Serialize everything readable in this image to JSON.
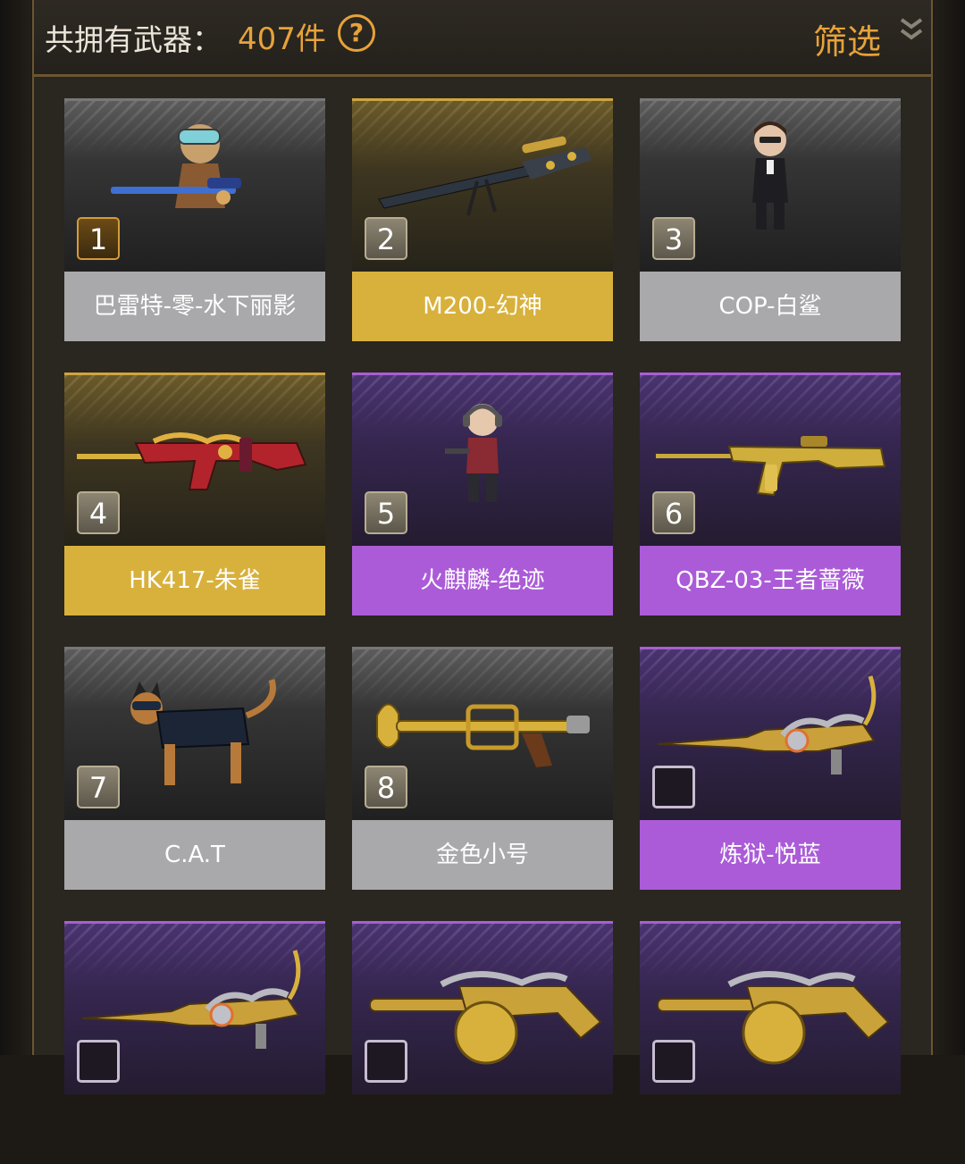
{
  "header": {
    "count_label": "共拥有武器：",
    "count_value": "407件",
    "help_icon": "?",
    "filter_label": "筛选"
  },
  "colors": {
    "accent": "#e7a23a",
    "rarity_white": "#a9a9ab",
    "rarity_gold": "#d8b13c",
    "rarity_purple": "#ab5bd8"
  },
  "items": [
    {
      "rank": "1",
      "name": "巴雷特-零-水下丽影",
      "rarity": "white",
      "icon": "character-sniper-icon"
    },
    {
      "rank": "2",
      "name": "M200-幻神",
      "rarity": "gold",
      "icon": "sniper-rifle-icon"
    },
    {
      "rank": "3",
      "name": "COP-白鲨",
      "rarity": "white",
      "icon": "character-suit-icon"
    },
    {
      "rank": "4",
      "name": "HK417-朱雀",
      "rarity": "gold",
      "icon": "assault-rifle-icon"
    },
    {
      "rank": "5",
      "name": "火麒麟-绝迹",
      "rarity": "purple",
      "icon": "character-headphones-icon"
    },
    {
      "rank": "6",
      "name": "QBZ-03-王者蔷薇",
      "rarity": "purple",
      "icon": "gold-rifle-icon"
    },
    {
      "rank": "7",
      "name": "C.A.T",
      "rarity": "white",
      "icon": "armored-cat-icon"
    },
    {
      "rank": "8",
      "name": "金色小号",
      "rarity": "white",
      "icon": "trumpet-gun-icon"
    },
    {
      "rank": "",
      "name": "炼狱-悦蓝",
      "rarity": "purple",
      "icon": "dragon-gun-icon"
    },
    {
      "rank": "",
      "name": "",
      "rarity": "purple",
      "icon": "dragon-gun-icon"
    },
    {
      "rank": "",
      "name": "",
      "rarity": "purple",
      "icon": "drum-smg-icon"
    },
    {
      "rank": "",
      "name": "",
      "rarity": "purple",
      "icon": "drum-smg-icon"
    }
  ]
}
